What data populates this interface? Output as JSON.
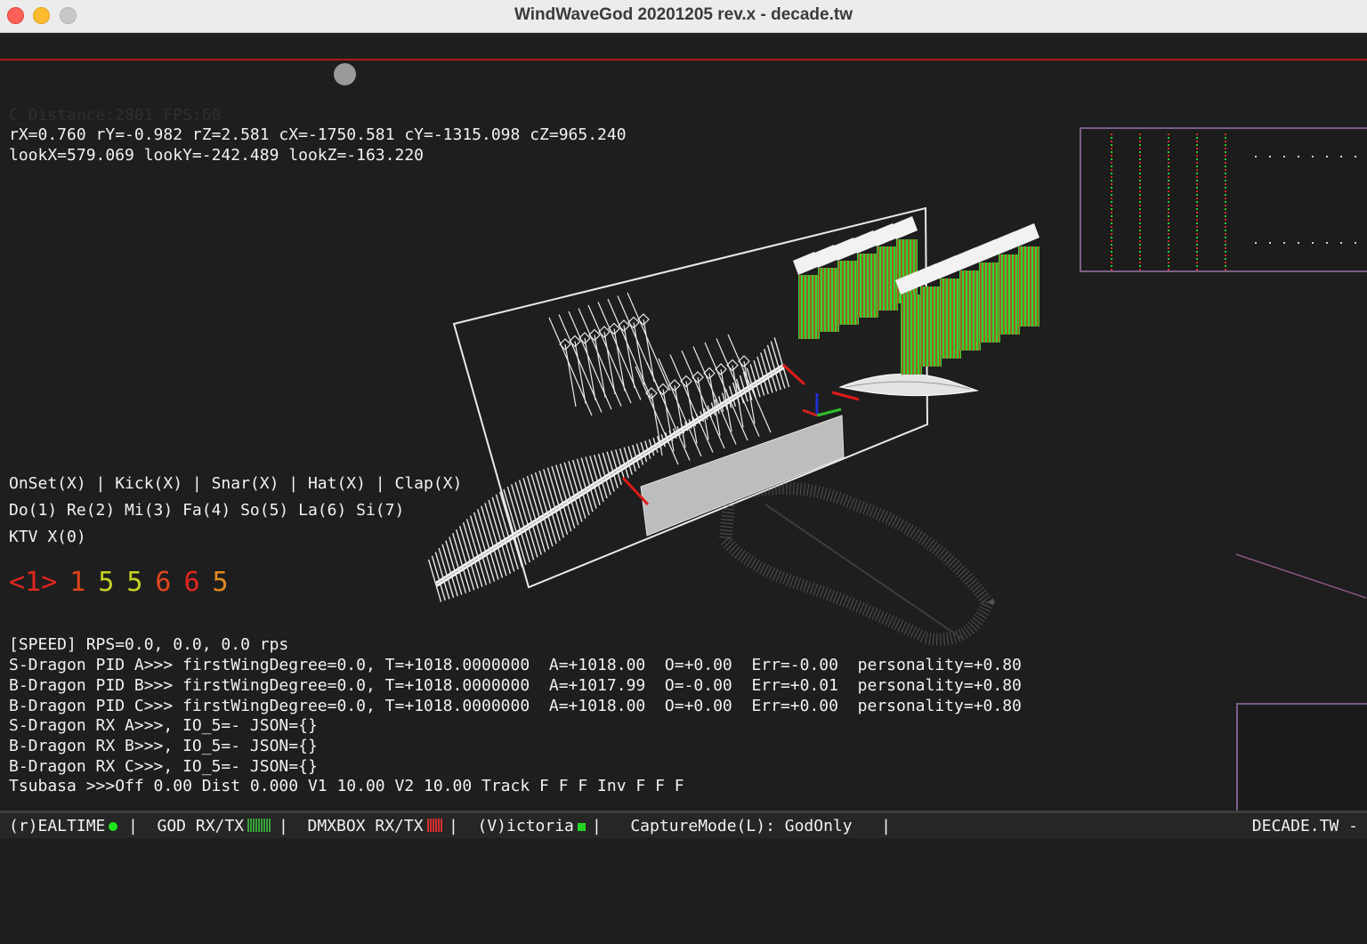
{
  "window": {
    "title": "WindWaveGod 20201205 rev.x - decade.tw"
  },
  "hud": {
    "distance_fps": "C_Distance:2801 FPS:60",
    "camera_line": "rX=0.760 rY=-0.982 rZ=2.581 cX=-1750.581 cY=-1315.098 cZ=965.240",
    "look_line": "lookX=579.069 lookY=-242.489 lookZ=-163.220"
  },
  "triggers": {
    "drums": "OnSet(X) | Kick(X) | Snar(X) | Hat(X) | Clap(X)",
    "scale": "Do(1) Re(2) Mi(3) Fa(4) So(5) La(6) Si(7)",
    "ktv": "KTV X(0)"
  },
  "notes": [
    {
      "text": "<1>",
      "color": "#e0261d"
    },
    {
      "text": "1",
      "color": "#e0431d"
    },
    {
      "text": "5",
      "color": "#c6d222"
    },
    {
      "text": "5",
      "color": "#c6d222"
    },
    {
      "text": "6",
      "color": "#e0451d"
    },
    {
      "text": "6",
      "color": "#e0261d"
    },
    {
      "text": "5",
      "color": "#e08a1d"
    }
  ],
  "log": [
    "[SPEED] RPS=0.0, 0.0, 0.0 rps",
    "S-Dragon PID A>>> firstWingDegree=0.0, T=+1018.0000000  A=+1018.00  O=+0.00  Err=-0.00  personality=+0.80",
    "B-Dragon PID B>>> firstWingDegree=0.0, T=+1018.0000000  A=+1017.99  O=-0.00  Err=+0.01  personality=+0.80",
    "B-Dragon PID C>>> firstWingDegree=0.0, T=+1018.0000000  A=+1018.00  O=+0.00  Err=+0.00  personality=+0.80",
    "S-Dragon RX A>>>, IO_5=- JSON={}",
    "B-Dragon RX B>>>, IO_5=- JSON={}",
    "B-Dragon RX C>>>, IO_5=- JSON={}",
    "Tsubasa >>>Off 0.00 Dist 0.000 V1 10.00 V2 10.00 Track F F F Inv F F F"
  ],
  "status": {
    "realtime": "(r)EALTIME",
    "god": "|  GOD RX/TX",
    "dmx": "|  DMXBOX RX/TX",
    "victoria": "|  (V)ictoria",
    "capture": "|   CaptureMode(L): GodOnly   |",
    "brand": "DECADE.TW -"
  },
  "colors": {
    "accent_red": "#b01818",
    "panel_border": "#7a5f86",
    "led_green": "#1ee61e"
  }
}
